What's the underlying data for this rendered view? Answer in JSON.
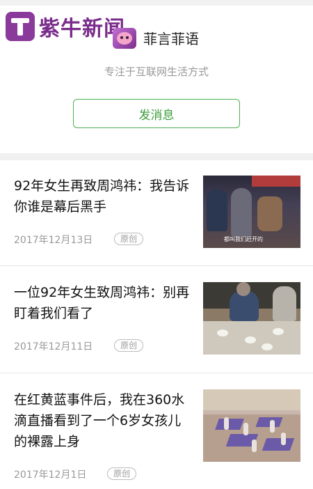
{
  "watermark": {
    "text": "紫牛新闻"
  },
  "account": {
    "name": "菲言菲语",
    "slogan": "专注于互联网生活方式",
    "send_message_label": "发消息"
  },
  "articles": [
    {
      "title": "92年女生再致周鸿祎：我告诉你谁是幕后黑手",
      "date": "2017年12月13日",
      "badge": "原创",
      "thumb_caption": "都叫我们赶开的"
    },
    {
      "title": "一位92年女生致周鸿祎：别再盯着我们看了",
      "date": "2017年12月11日",
      "badge": "原创"
    },
    {
      "title": "在红黄蓝事件后，我在360水滴直播看到了一个6岁女孩儿的裸露上身",
      "date": "2017年12月1日",
      "badge": "原创"
    }
  ],
  "colors": {
    "accent_green": "#4caf50",
    "watermark_purple": "#7a2c8a",
    "meta_gray": "#999999"
  }
}
